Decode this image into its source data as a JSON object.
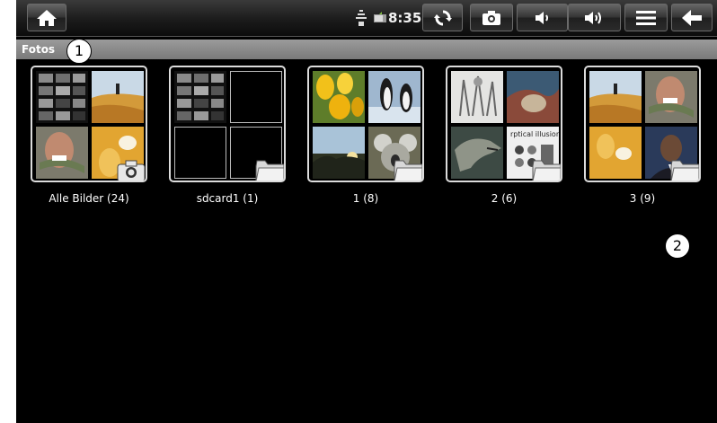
{
  "status": {
    "time": "8:35"
  },
  "title": "Fotos",
  "callouts": [
    "1",
    "2"
  ],
  "albums": [
    {
      "label": "Alle Bilder (24)"
    },
    {
      "label": "sdcard1 (1)"
    },
    {
      "label": "1 (8)"
    },
    {
      "label": "2 (6)"
    },
    {
      "label": "3 (9)"
    }
  ],
  "thumb_text": "rptical illusion"
}
